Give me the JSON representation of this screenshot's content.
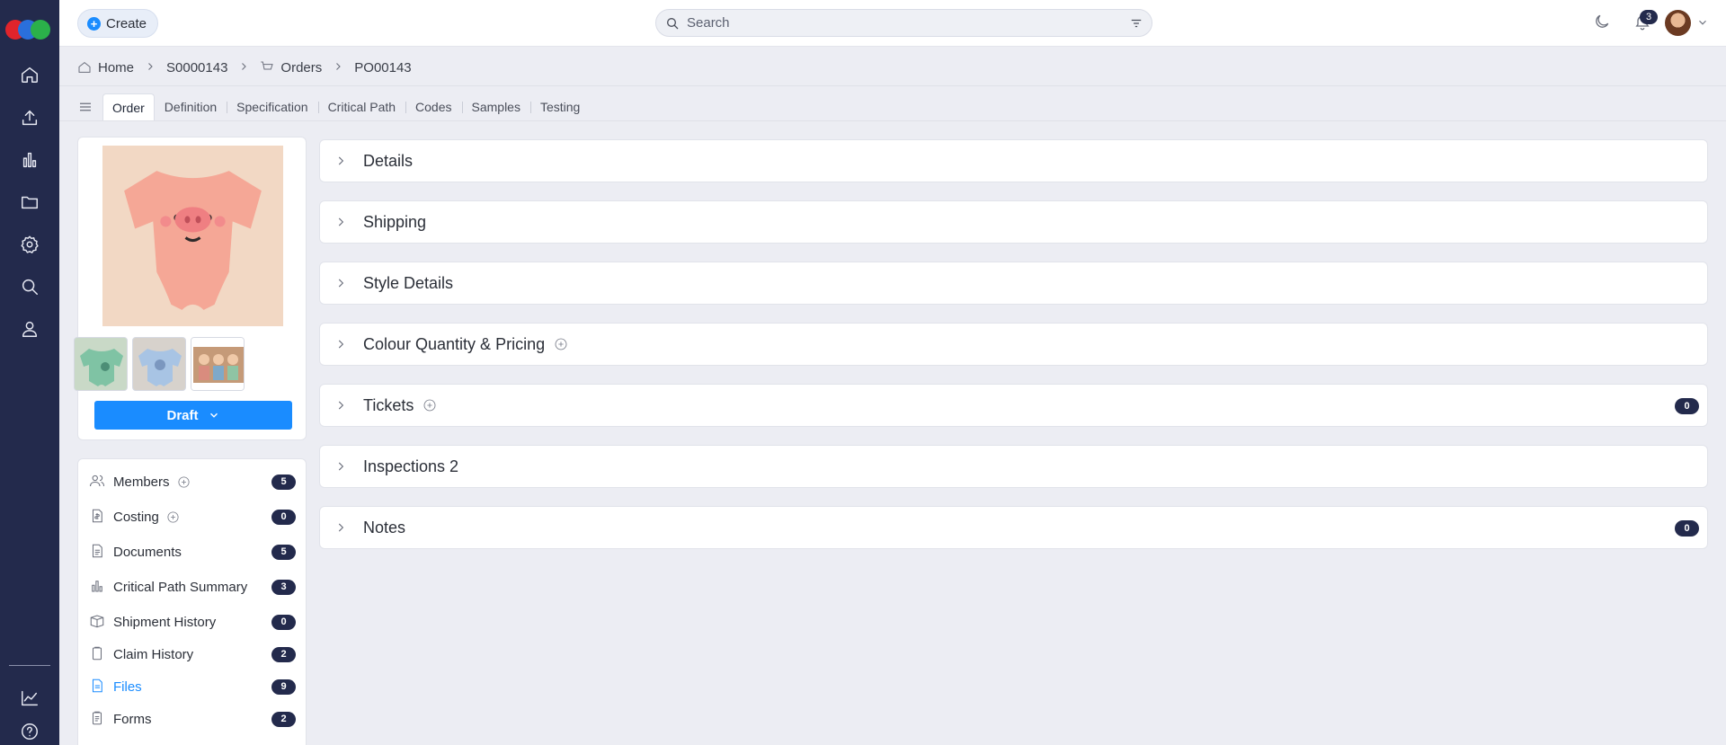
{
  "topbar": {
    "create_label": "Create",
    "search_placeholder": "Search",
    "notifications_count": "3"
  },
  "breadcrumb": [
    {
      "label": "Home",
      "icon": "home-icon"
    },
    {
      "label": "S0000143"
    },
    {
      "label": "Orders",
      "icon": "cart-icon"
    },
    {
      "label": "PO00143"
    }
  ],
  "tabs": [
    "Order",
    "Definition",
    "Specification",
    "Critical Path",
    "Codes",
    "Samples",
    "Testing"
  ],
  "active_tab": "Order",
  "product": {
    "status_label": "Draft"
  },
  "side_list": [
    {
      "label": "Members",
      "count": "5",
      "icon": "users-icon",
      "add": true
    },
    {
      "label": "Costing",
      "count": "0",
      "icon": "price-tag-icon",
      "add": true
    },
    {
      "label": "Documents",
      "count": "5",
      "icon": "document-icon"
    },
    {
      "label": "Critical Path Summary",
      "count": "3",
      "icon": "bar-chart-icon"
    },
    {
      "label": "Shipment History",
      "count": "0",
      "icon": "box-icon"
    },
    {
      "label": "Claim History",
      "count": "2",
      "icon": "clipboard-icon"
    },
    {
      "label": "Files",
      "count": "9",
      "icon": "file-icon",
      "active": true
    },
    {
      "label": "Forms",
      "count": "2",
      "icon": "form-icon"
    }
  ],
  "sections": [
    {
      "title": "Details"
    },
    {
      "title": "Shipping"
    },
    {
      "title": "Style Details"
    },
    {
      "title": "Colour Quantity & Pricing",
      "add": true
    },
    {
      "title": "Tickets",
      "add": true,
      "count": "0"
    },
    {
      "title": "Inspections 2"
    },
    {
      "title": "Notes",
      "count": "0"
    }
  ],
  "colors": {
    "rail": "#232a4c",
    "accent": "#1a8cff",
    "badge": "#232a4c",
    "background": "#ecedf3"
  }
}
